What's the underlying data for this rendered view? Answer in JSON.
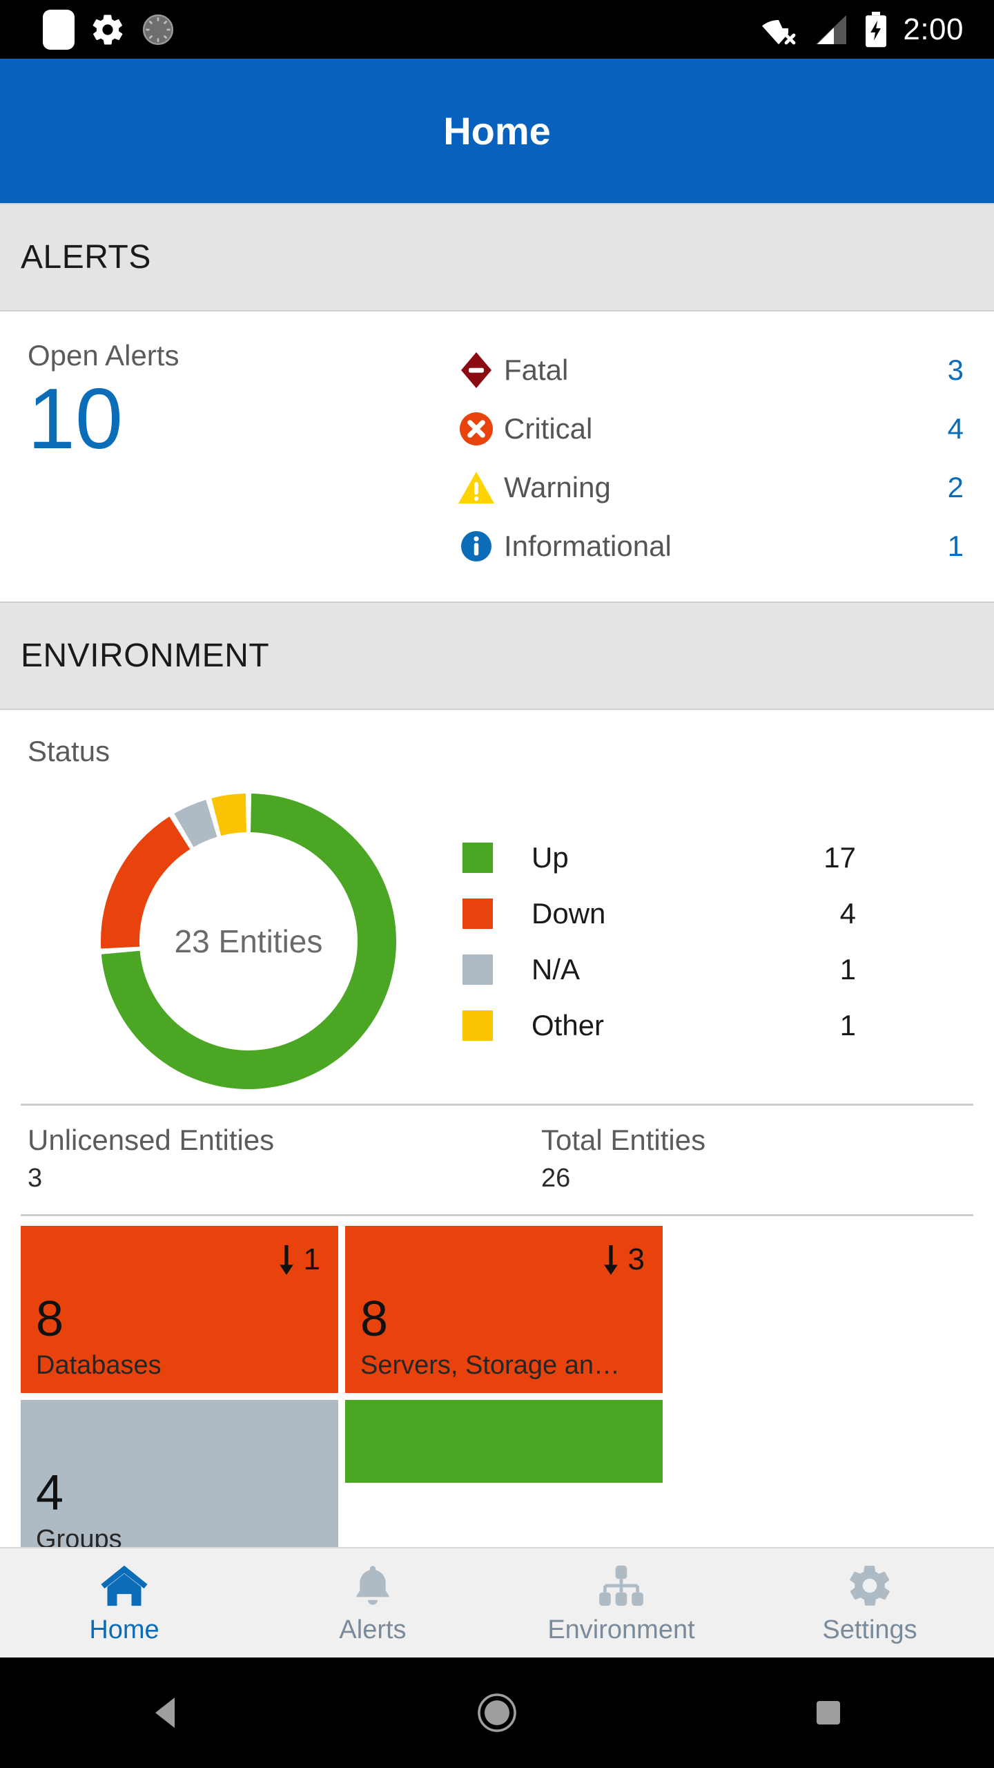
{
  "status_bar": {
    "time": "2:00",
    "icons": [
      "notification-square-icon",
      "gear-icon",
      "sync-spinner-icon",
      "wifi-off-icon",
      "cellular-signal-icon",
      "battery-charging-icon"
    ]
  },
  "app_bar": {
    "title": "Home"
  },
  "alerts_section": {
    "band_label": "ALERTS",
    "open_alerts_label": "Open Alerts",
    "open_alerts_count": "10",
    "rows": [
      {
        "icon": "fatal-diamond-icon",
        "label": "Fatal",
        "count": "3",
        "color": "#8C0B13"
      },
      {
        "icon": "critical-circle-x-icon",
        "label": "Critical",
        "count": "4",
        "color": "#E8430C"
      },
      {
        "icon": "warning-triangle-icon",
        "label": "Warning",
        "count": "2",
        "color": "#FFD300"
      },
      {
        "icon": "informational-info-icon",
        "label": "Informational",
        "count": "1",
        "color": "#0B6CB8"
      }
    ]
  },
  "environment_section": {
    "band_label": "ENVIRONMENT",
    "status_label": "Status",
    "donut_center": "23 Entities",
    "totals": [
      {
        "label": "Unlicensed Entities",
        "value": "3"
      },
      {
        "label": "Total Entities",
        "value": "26"
      }
    ],
    "tiles": [
      {
        "number": "8",
        "label": "Databases",
        "badge": "1",
        "badge_icon": "down-arrow-icon",
        "color": "#E8430C"
      },
      {
        "number": "8",
        "label": "Servers, Storage an…",
        "badge": "3",
        "badge_icon": "down-arrow-icon",
        "color": "#E8430C"
      },
      {
        "number": "4",
        "label": "Groups",
        "badge": "",
        "badge_icon": "",
        "color": "#AEBAC4"
      },
      {
        "number": "",
        "label": "",
        "badge": "",
        "badge_icon": "",
        "color": "#4BA623"
      },
      {
        "number": "",
        "label": "",
        "badge": "",
        "badge_icon": "",
        "color": "#4BA623"
      }
    ]
  },
  "chart_data": {
    "type": "pie",
    "title": "Status",
    "center_label": "23 Entities",
    "total": 23,
    "categories": [
      "Up",
      "Down",
      "N/A",
      "Other"
    ],
    "values": [
      17,
      4,
      1,
      1
    ],
    "colors": [
      "#4BA623",
      "#E8430C",
      "#AEBAC4",
      "#FBC403"
    ],
    "legend_position": "right",
    "legend": [
      {
        "label": "Up",
        "value": "17",
        "color": "#4BA623"
      },
      {
        "label": "Down",
        "value": "4",
        "color": "#E8430C"
      },
      {
        "label": "N/A",
        "value": "1",
        "color": "#AEBAC4"
      },
      {
        "label": "Other",
        "value": "1",
        "color": "#FBC403"
      }
    ]
  },
  "tab_bar": {
    "tabs": [
      {
        "label": "Home",
        "icon": "home-icon",
        "active": true
      },
      {
        "label": "Alerts",
        "icon": "bell-icon",
        "active": false
      },
      {
        "label": "Environment",
        "icon": "hierarchy-icon",
        "active": false
      },
      {
        "label": "Settings",
        "icon": "gear-icon",
        "active": false
      }
    ]
  },
  "android_nav": {
    "buttons": [
      {
        "name": "back-button",
        "icon": "back-triangle-icon"
      },
      {
        "name": "home-button",
        "icon": "home-circle-icon"
      },
      {
        "name": "recents-button",
        "icon": "recents-square-icon"
      }
    ]
  },
  "theme": {
    "primary": "#0961BE",
    "link": "#0B6CB8",
    "band_bg": "#E4E4E4",
    "tab_inactive": "#AEBAC4"
  }
}
